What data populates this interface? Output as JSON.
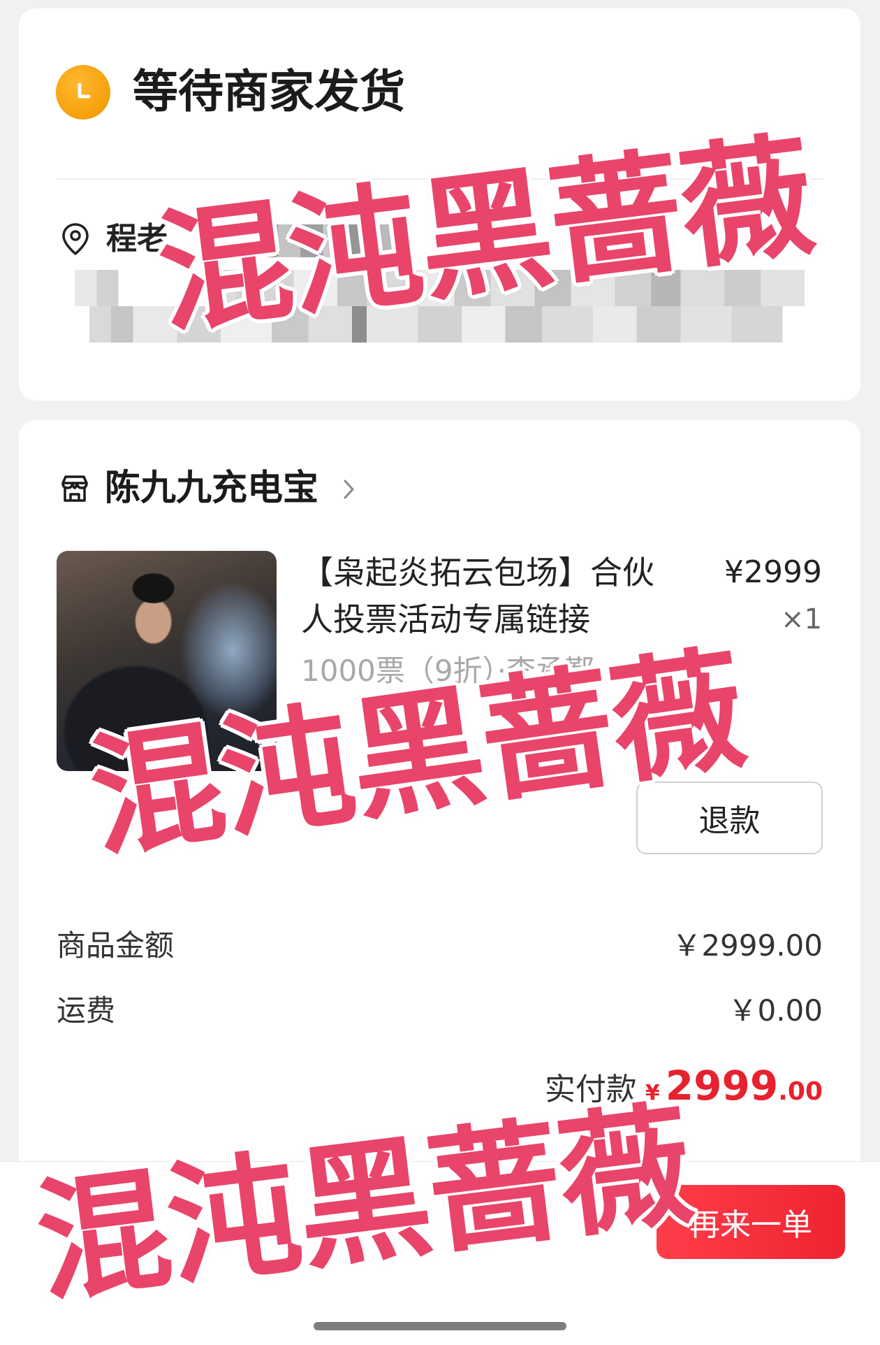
{
  "status": {
    "icon": "clock-icon",
    "title": "等待商家发货"
  },
  "address": {
    "icon": "location-pin-icon",
    "name": "程老"
  },
  "shop": {
    "icon": "store-icon",
    "name": "陈九九充电宝",
    "chevron_icon": "chevron-right-icon"
  },
  "product": {
    "title": "【枭起炎拓云包场】合伙人投票活动专属链接",
    "price": "¥2999",
    "quantity": "×1",
    "spec": "1000票（9折）·李承鄞",
    "refund_label": "退款"
  },
  "summary": {
    "goods_label": "商品金额",
    "goods_value": "￥2999.00",
    "shipping_label": "运费",
    "shipping_value": "￥0.00",
    "paid_label": "实付款",
    "paid_currency": "¥",
    "paid_int": "2999",
    "paid_dec": ".00"
  },
  "footer": {
    "reorder_label": "再来一单"
  },
  "watermark": {
    "text": "混沌黑蔷薇"
  },
  "colors": {
    "status_icon": "#f5a00c",
    "price_red": "#e8212e",
    "button_red": "#ee2430",
    "watermark": "#e9446a",
    "page_bg": "#f1f1f1"
  }
}
